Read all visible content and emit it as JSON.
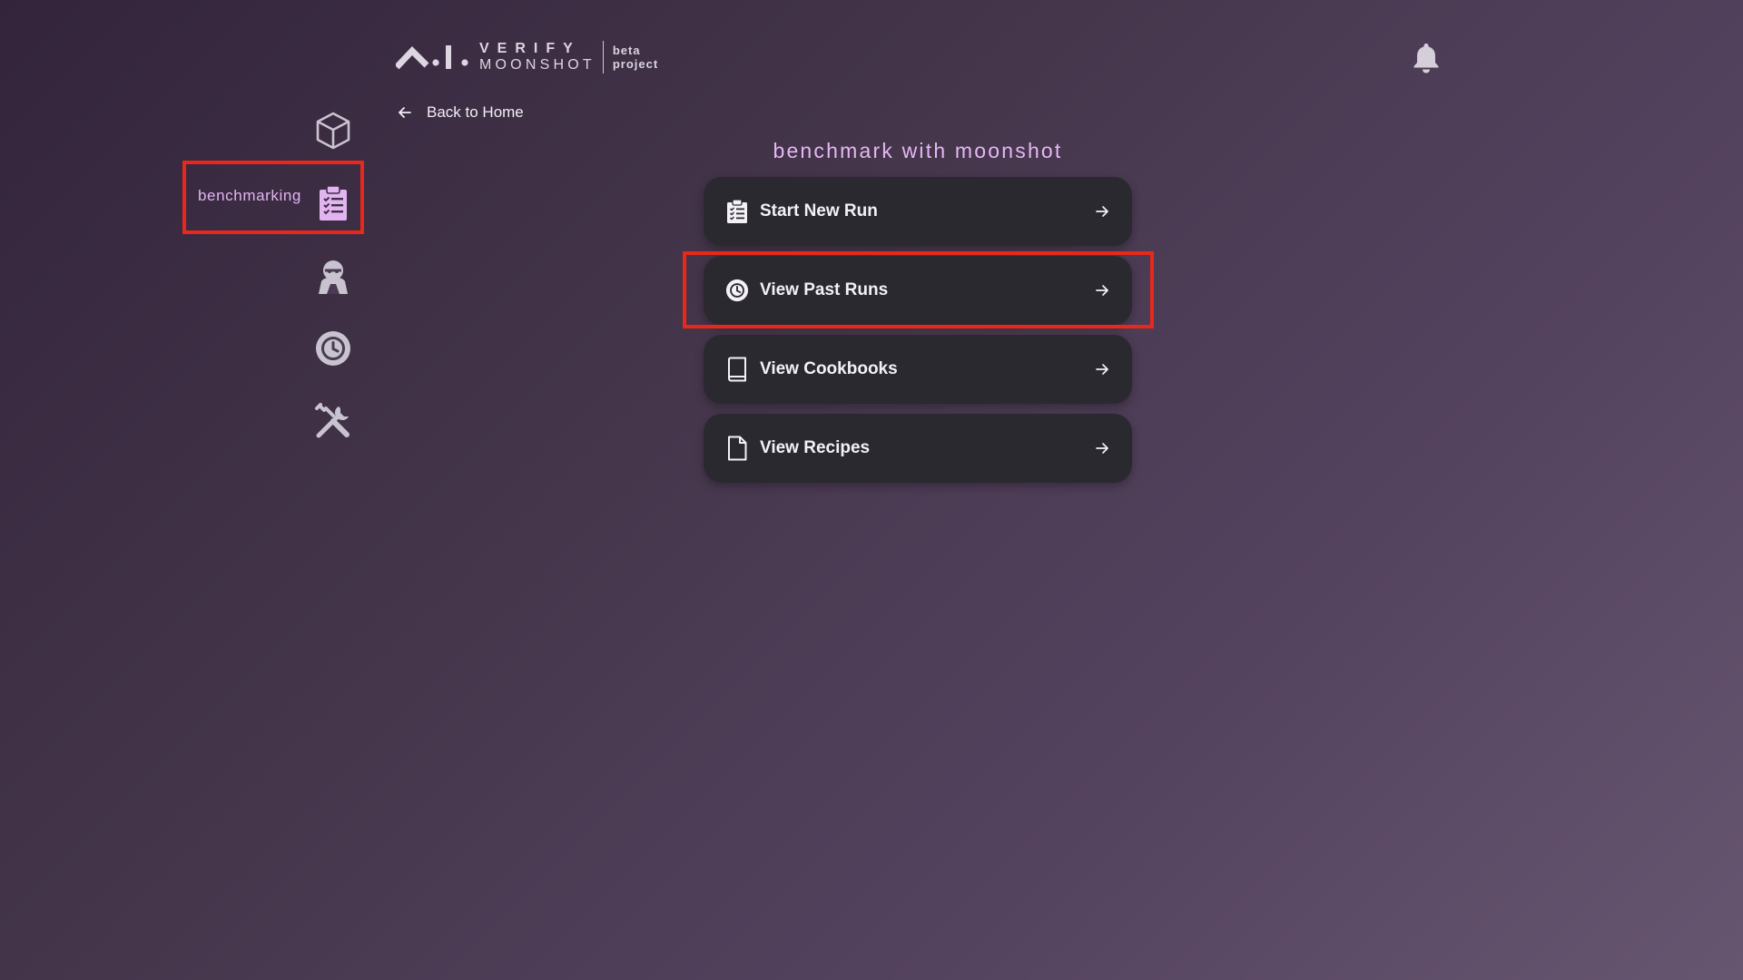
{
  "header": {
    "logo_word_top": "VERIFY",
    "logo_word_bottom": "MOONSHOT",
    "logo_tag_line1": "beta",
    "logo_tag_line2": "project"
  },
  "sidebar": {
    "items": [
      {
        "icon": "cube-icon"
      },
      {
        "icon": "clipboard-list-icon",
        "label": "benchmarking",
        "active": true
      },
      {
        "icon": "agent-icon"
      },
      {
        "icon": "history-icon"
      },
      {
        "icon": "tools-icon"
      }
    ]
  },
  "back_link": {
    "label": "Back to Home"
  },
  "main": {
    "title": "benchmark with moonshot",
    "menu": [
      {
        "label": "Start New Run",
        "icon": "clipboard-list-icon"
      },
      {
        "label": "View Past Runs",
        "icon": "history-icon",
        "highlighted": true
      },
      {
        "label": "View Cookbooks",
        "icon": "book-icon"
      },
      {
        "label": "View Recipes",
        "icon": "file-icon"
      }
    ]
  },
  "colors": {
    "accent": "#e3b5f0",
    "card_bg": "#2b2930",
    "highlight": "#e8281a",
    "icon_gray": "#c9c3cf"
  }
}
